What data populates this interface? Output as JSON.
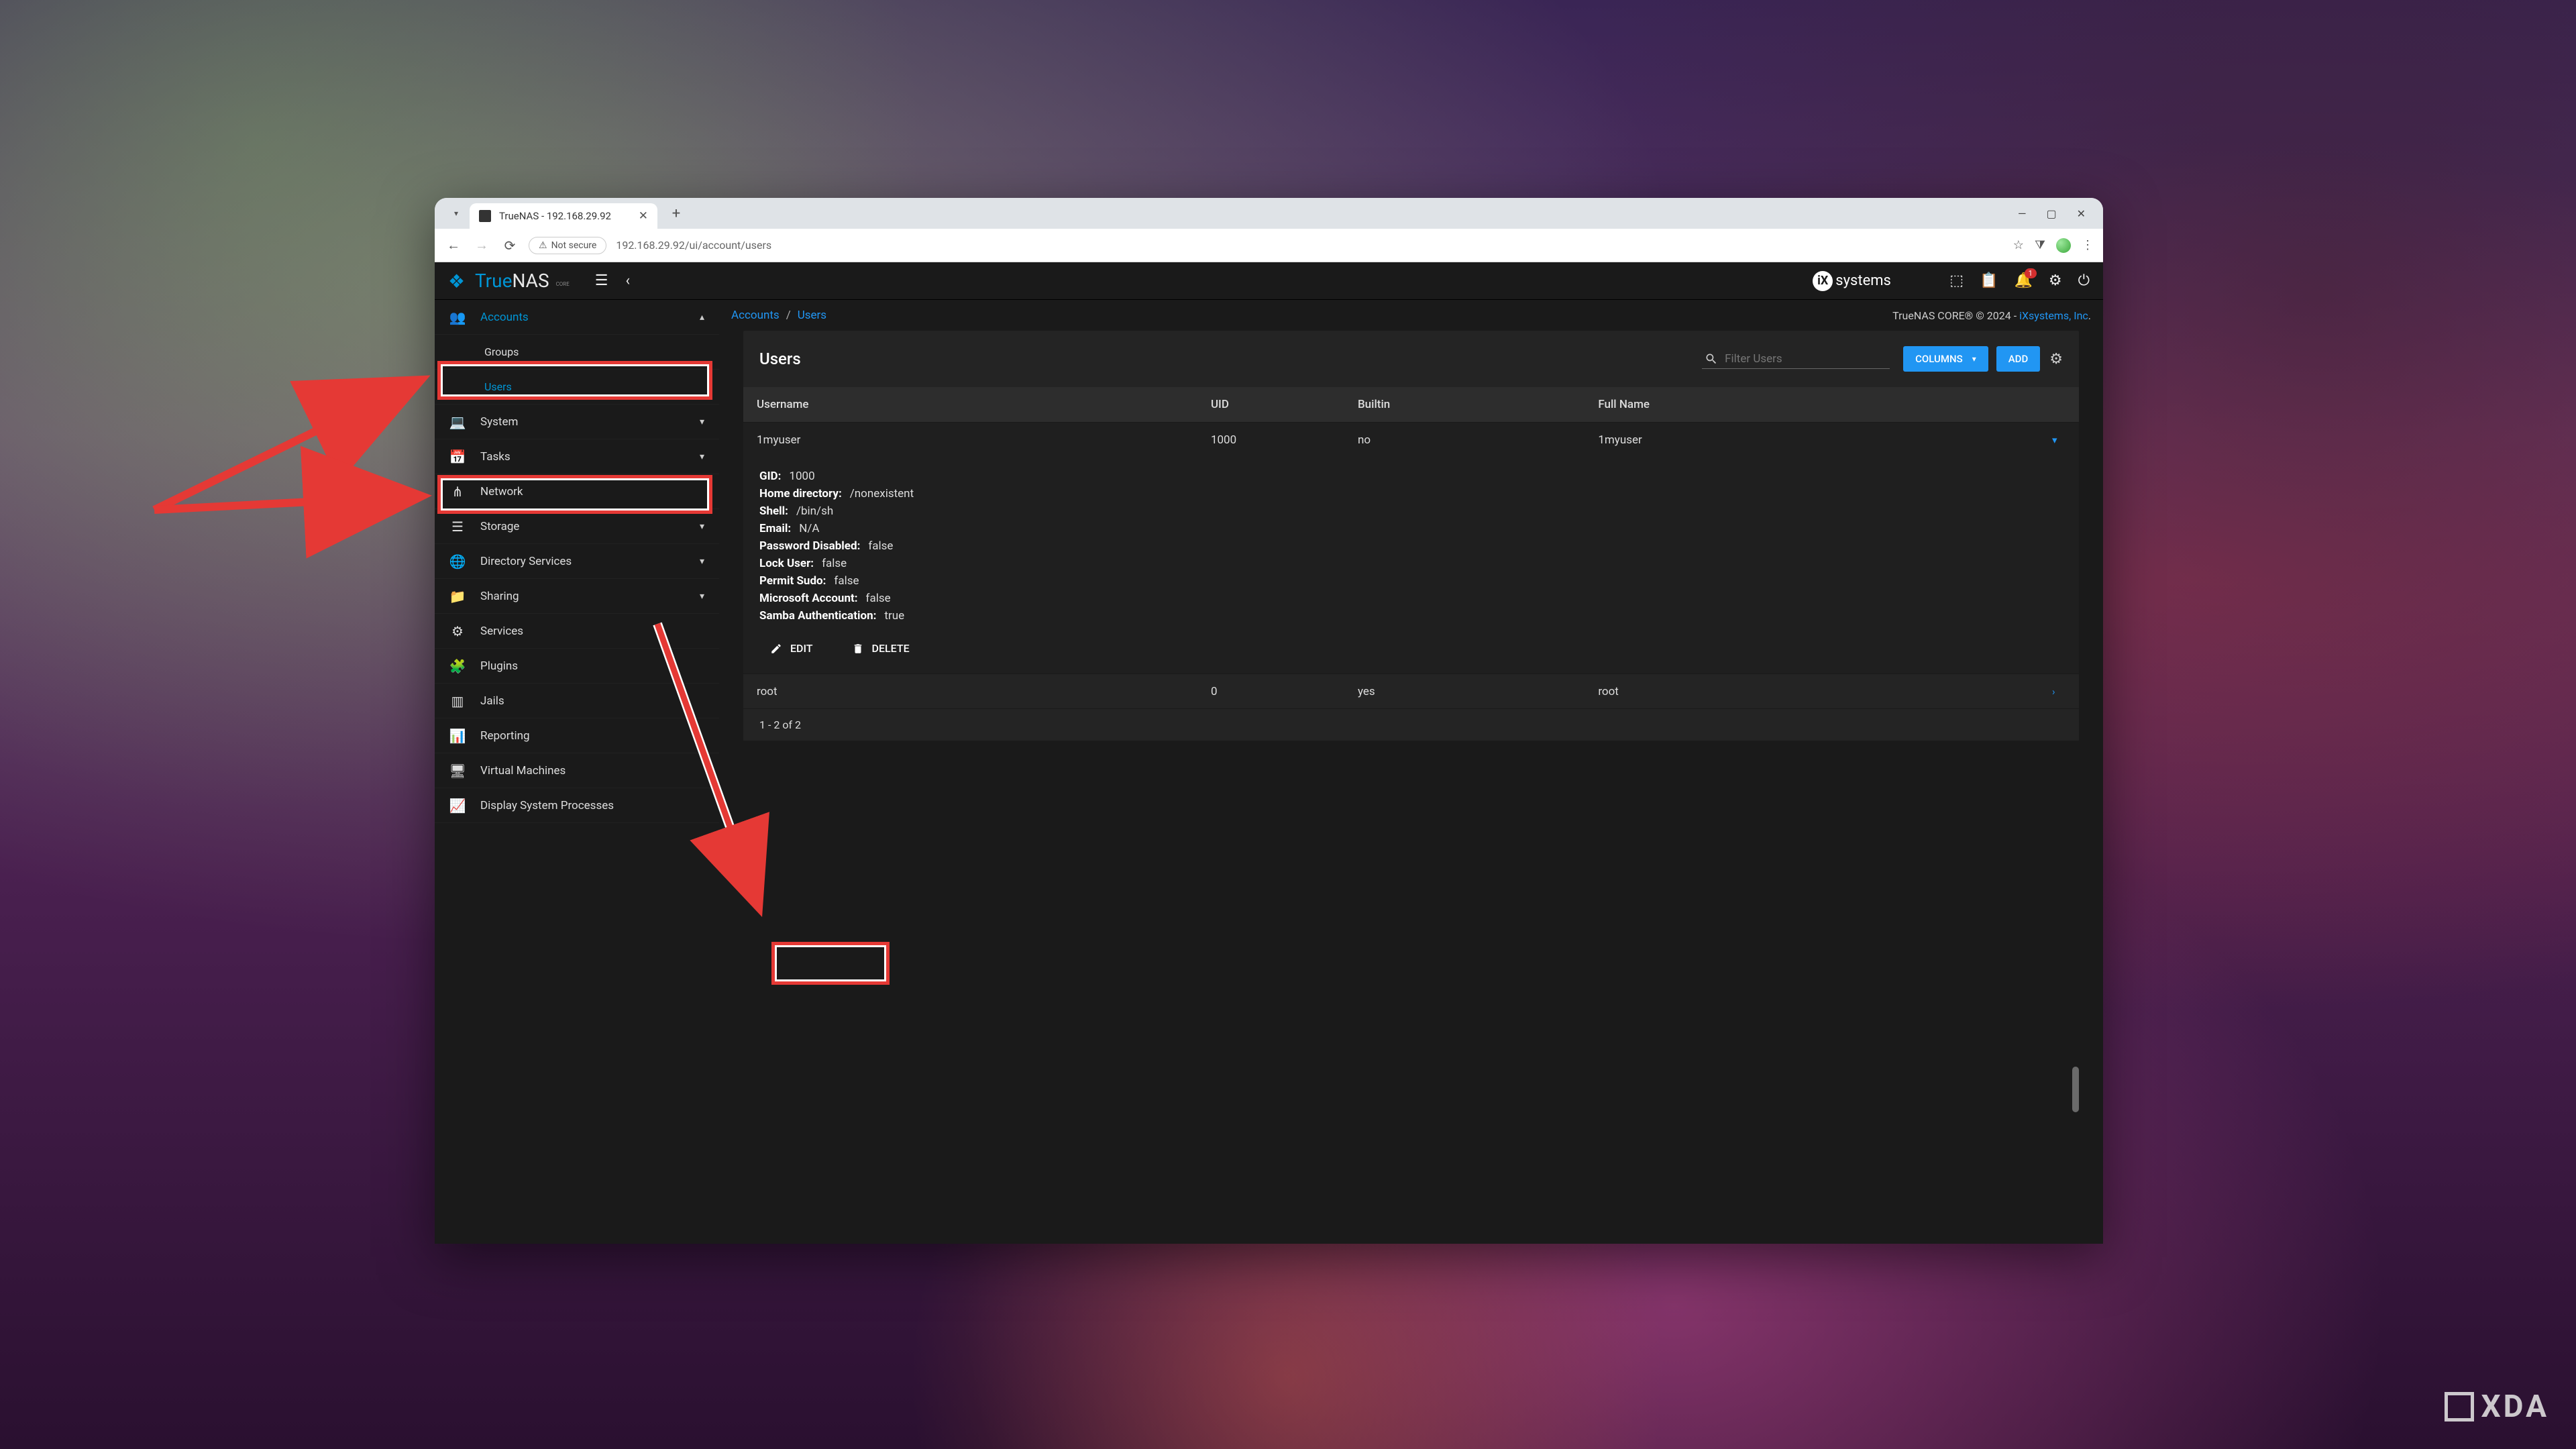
{
  "browser": {
    "tab_title": "TrueNAS - 192.168.29.92",
    "security_label": "Not secure",
    "url": "192.168.29.92/ui/account/users"
  },
  "app": {
    "brand_a": "True",
    "brand_b": "NAS",
    "brand_sub": "CORE",
    "isys": "systems",
    "notif_count": "1"
  },
  "sidebar": [
    {
      "icon": "people",
      "label": "Accounts",
      "active": true,
      "expand": "▴"
    },
    {
      "sub": true,
      "label": "Groups"
    },
    {
      "sub": true,
      "label": "Users",
      "active": true
    },
    {
      "icon": "laptop",
      "label": "System",
      "expand": "▾"
    },
    {
      "icon": "calendar",
      "label": "Tasks",
      "expand": "▾"
    },
    {
      "icon": "share",
      "label": "Network"
    },
    {
      "icon": "disk",
      "label": "Storage",
      "expand": "▾"
    },
    {
      "icon": "globe",
      "label": "Directory Services",
      "expand": "▾"
    },
    {
      "icon": "folder",
      "label": "Sharing",
      "expand": "▾"
    },
    {
      "icon": "sliders",
      "label": "Services"
    },
    {
      "icon": "puzzle",
      "label": "Plugins"
    },
    {
      "icon": "jail",
      "label": "Jails"
    },
    {
      "icon": "chart",
      "label": "Reporting"
    },
    {
      "icon": "vm",
      "label": "Virtual Machines"
    },
    {
      "icon": "proc",
      "label": "Display System Processes"
    }
  ],
  "breadcrumb": {
    "a": "Accounts",
    "b": "Users",
    "copyright": "TrueNAS CORE® © 2024 - ",
    "link": "iXsystems, Inc"
  },
  "panel": {
    "title": "Users",
    "filter_placeholder": "Filter Users",
    "columns_btn": "COLUMNS",
    "add_btn": "ADD"
  },
  "table": {
    "headers": {
      "username": "Username",
      "uid": "UID",
      "builtin": "Builtin",
      "fullname": "Full Name"
    },
    "rows": [
      {
        "username": "1myuser",
        "uid": "1000",
        "builtin": "no",
        "fullname": "1myuser",
        "chev": "▾",
        "expanded": true
      },
      {
        "username": "root",
        "uid": "0",
        "builtin": "yes",
        "fullname": "root",
        "chev": "›"
      }
    ],
    "details": [
      {
        "k": "GID:",
        "v": "1000"
      },
      {
        "k": "Home directory:",
        "v": "/nonexistent"
      },
      {
        "k": "Shell:",
        "v": "/bin/sh"
      },
      {
        "k": "Email:",
        "v": "N/A"
      },
      {
        "k": "Password Disabled:",
        "v": "false"
      },
      {
        "k": "Lock User:",
        "v": "false"
      },
      {
        "k": "Permit Sudo:",
        "v": "false"
      },
      {
        "k": "Microsoft Account:",
        "v": "false"
      },
      {
        "k": "Samba Authentication:",
        "v": "true"
      }
    ],
    "edit": "EDIT",
    "delete": "DELETE",
    "pager": "1 - 2 of 2"
  },
  "watermark": "XDA"
}
